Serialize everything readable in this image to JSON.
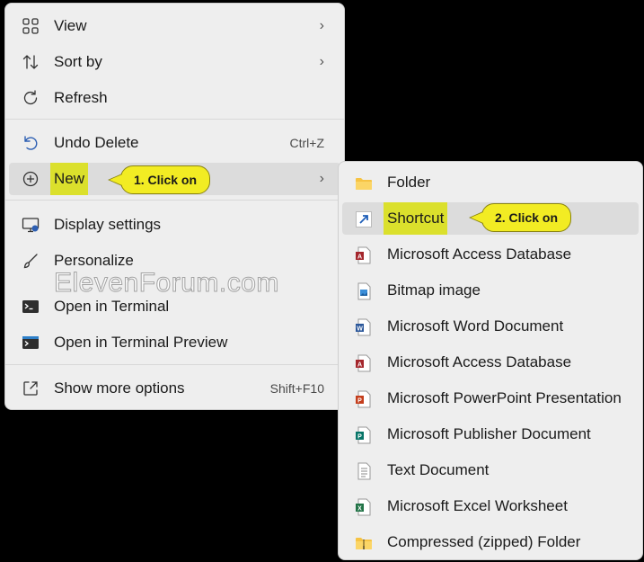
{
  "main_menu": {
    "items": [
      {
        "label": "View",
        "icon": "grid-icon",
        "has_submenu": true
      },
      {
        "label": "Sort by",
        "icon": "sort-icon",
        "has_submenu": true
      },
      {
        "label": "Refresh",
        "icon": "refresh-icon"
      },
      {
        "label": "Undo Delete",
        "icon": "undo-icon",
        "shortcut": "Ctrl+Z"
      },
      {
        "label": "New",
        "icon": "new-icon",
        "has_submenu": true,
        "highlighted": true
      },
      {
        "label": "Display settings",
        "icon": "display-icon"
      },
      {
        "label": "Personalize",
        "icon": "brush-icon"
      },
      {
        "label": "Open in Terminal",
        "icon": "terminal-icon"
      },
      {
        "label": "Open in Terminal Preview",
        "icon": "terminal-preview-icon"
      },
      {
        "label": "Show more options",
        "icon": "share-icon",
        "shortcut": "Shift+F10"
      }
    ],
    "chevron": "›"
  },
  "sub_menu": {
    "items": [
      {
        "label": "Folder",
        "icon": "folder-icon"
      },
      {
        "label": "Shortcut",
        "icon": "shortcut-icon",
        "highlighted": true
      },
      {
        "label": "Microsoft Access Database",
        "icon": "access-icon"
      },
      {
        "label": "Bitmap image",
        "icon": "bitmap-icon"
      },
      {
        "label": "Microsoft Word Document",
        "icon": "word-icon"
      },
      {
        "label": "Microsoft Access Database",
        "icon": "access-icon"
      },
      {
        "label": "Microsoft PowerPoint Presentation",
        "icon": "powerpoint-icon"
      },
      {
        "label": "Microsoft Publisher Document",
        "icon": "publisher-icon"
      },
      {
        "label": "Text Document",
        "icon": "text-icon"
      },
      {
        "label": "Microsoft Excel Worksheet",
        "icon": "excel-icon"
      },
      {
        "label": "Compressed (zipped) Folder",
        "icon": "zip-folder-icon"
      }
    ]
  },
  "callouts": {
    "step1": "1. Click on",
    "step2": "2. Click on"
  },
  "watermark": "ElevenForum.com",
  "colors": {
    "menu_bg": "#eeeeee",
    "highlight": "#dcdcdc",
    "callout_yellow": "#f2ec23",
    "label_highlight": "#dbe02c"
  }
}
